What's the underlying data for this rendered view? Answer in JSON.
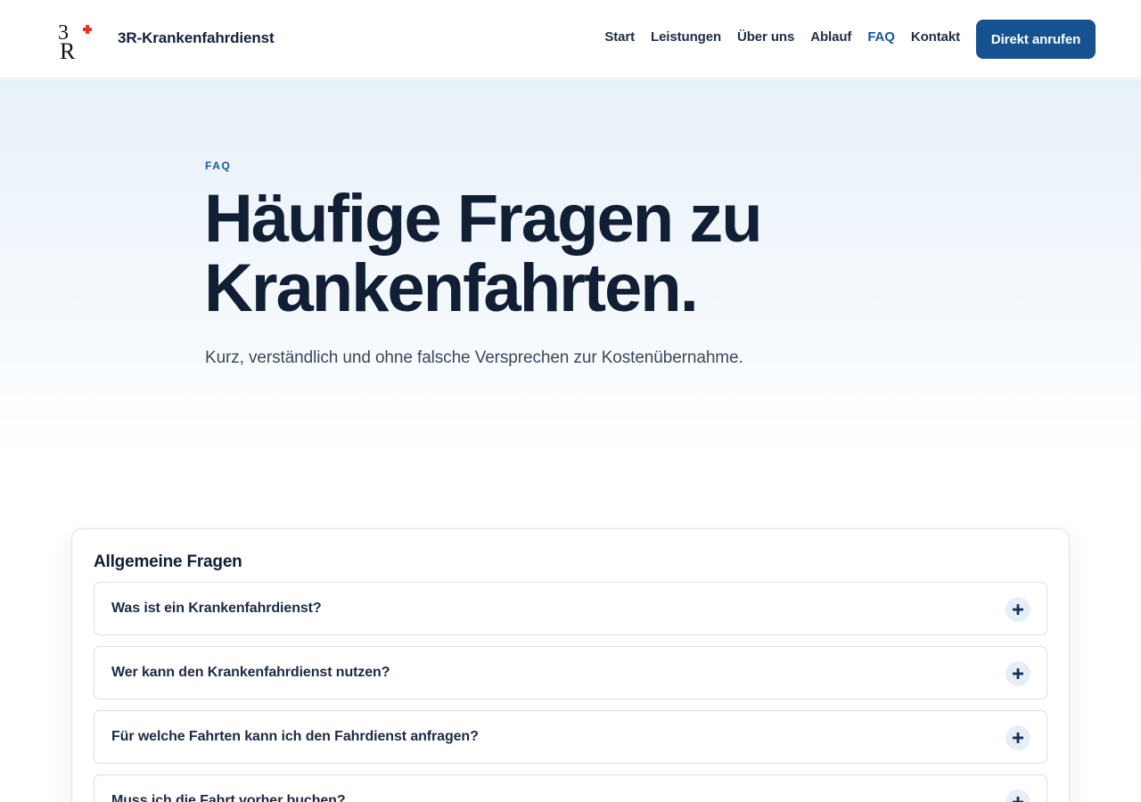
{
  "header": {
    "brand_name": "3R-Krankenfahrdienst",
    "logo_text": "3R",
    "nav": [
      {
        "label": "Start",
        "active": false
      },
      {
        "label": "Leistungen",
        "active": false
      },
      {
        "label": "Über uns",
        "active": false
      },
      {
        "label": "Ablauf",
        "active": false
      },
      {
        "label": "FAQ",
        "active": true
      },
      {
        "label": "Kontakt",
        "active": false
      }
    ],
    "cta_label": "Direkt anrufen"
  },
  "hero": {
    "eyebrow": "FAQ",
    "title_line1": "Häufige Fragen zu",
    "title_line2": "Krankenfahrten.",
    "subtitle": "Kurz, verständlich und ohne falsche Versprechen zur Kostenübernahme."
  },
  "faq": {
    "section_title": "Allgemeine Fragen",
    "items": [
      {
        "question": "Was ist ein Krankenfahrdienst?",
        "icon": "plus-icon"
      },
      {
        "question": "Wer kann den Krankenfahrdienst nutzen?",
        "icon": "plus-icon"
      },
      {
        "question": "Für welche Fahrten kann ich den Fahrdienst anfragen?",
        "icon": "plus-icon"
      },
      {
        "question": "Muss ich die Fahrt vorher buchen?",
        "icon": "plus-icon"
      }
    ]
  },
  "colors": {
    "primary": "#15528f",
    "accent_red": "#e8341c",
    "text_dark": "#111e33",
    "nav_active": "#15589a"
  }
}
